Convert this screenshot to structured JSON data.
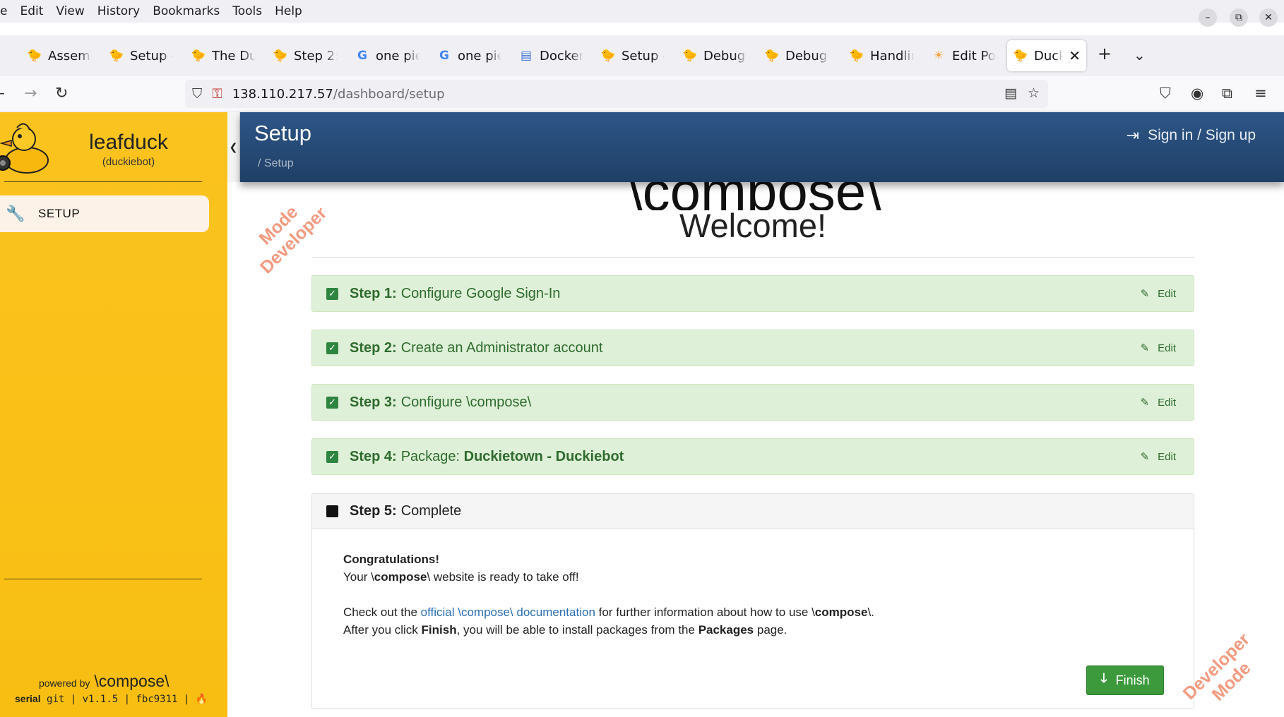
{
  "browser": {
    "menu": [
      "e",
      "Edit",
      "View",
      "History",
      "Bookmarks",
      "Tools",
      "Help"
    ],
    "tabs": [
      {
        "title": "Assemb",
        "icon": "duck-favicon"
      },
      {
        "title": "Setup -",
        "icon": "duck-favicon"
      },
      {
        "title": "The Du",
        "icon": "duck-favicon"
      },
      {
        "title": "Step 2:",
        "icon": "duck-favicon"
      },
      {
        "title": "one pie",
        "icon": "google-favicon"
      },
      {
        "title": "one pie",
        "icon": "google-favicon"
      },
      {
        "title": "Docker",
        "icon": "docs-favicon"
      },
      {
        "title": "Setup -",
        "icon": "duck-favicon"
      },
      {
        "title": "Debug",
        "icon": "duck-favicon"
      },
      {
        "title": "Debug",
        "icon": "duck-favicon"
      },
      {
        "title": "Handlin",
        "icon": "duck-favicon"
      },
      {
        "title": "Edit Po",
        "icon": "sun-favicon"
      },
      {
        "title": "Duck",
        "icon": "duck-favicon",
        "active": true
      }
    ],
    "url_host": "138.110.217.57",
    "url_path": "/dashboard/setup"
  },
  "sidebar": {
    "robot_name": "leafduck",
    "robot_type": "(duckiebot)",
    "items": [
      {
        "label": "SETUP",
        "icon": "wrench-icon"
      }
    ],
    "powered_by": "powered by",
    "brand": "\\compose\\",
    "build_serial": "serial",
    "build_info": "git | v1.1.5 | fbc9311 |"
  },
  "header": {
    "title": "Setup",
    "breadcrumb": "/  Setup",
    "sign_in": "Sign in / Sign up"
  },
  "main": {
    "logo_text": "\\compose\\",
    "welcome": "Welcome!",
    "watermark_line1": "Mode",
    "watermark_line2": "Developer",
    "watermark2_line1": "Developer",
    "watermark2_line2": "Mode",
    "edit_label": "Edit",
    "steps": [
      {
        "label": "Step 1:",
        "text": "Configure Google Sign-In"
      },
      {
        "label": "Step 2:",
        "text": "Create an Administrator account"
      },
      {
        "label": "Step 3:",
        "text": "Configure \\compose\\"
      },
      {
        "label": "Step 4:",
        "text_pre": "Package: ",
        "text_bold": "Duckietown - Duckiebot"
      }
    ],
    "step5": {
      "label": "Step 5:",
      "text": "Complete",
      "congrats": "Congratulations!",
      "line1_pre": "Your \\",
      "line1_bold": "compose",
      "line1_post": "\\ website is ready to take off!",
      "line2_pre": "Check out the ",
      "line2_link": "official \\compose\\ documentation",
      "line2_mid": " for further information about how to use \\",
      "line2_bold": "compose",
      "line2_post": "\\.",
      "line3_pre": "After you click ",
      "line3_b1": "Finish",
      "line3_mid": ", you will be able to install packages from the ",
      "line3_b2": "Packages",
      "line3_post": " page.",
      "finish_label": "Finish"
    }
  },
  "colors": {
    "sidebar": "#fbc31f",
    "header": "#2e5688",
    "step_done_bg": "#dff0d8",
    "step_done_text": "#2e6b2e",
    "finish_button": "#3c9a3c",
    "link": "#2a6fb5",
    "watermark": "#f08a6a"
  }
}
